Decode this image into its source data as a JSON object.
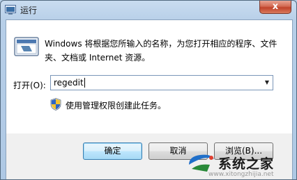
{
  "window": {
    "title": "运行",
    "close_label": "x"
  },
  "dialog": {
    "description": "Windows 将根据您所输入的名称，为您打开相应的程序、文件夹、文档或 Internet 资源。",
    "open_label": "打开(O):",
    "open_value": "regedit",
    "admin_note": "使用管理权限创建此任务。"
  },
  "buttons": {
    "ok": "确定",
    "cancel": "取消",
    "browse": "浏览(B)..."
  },
  "watermark": {
    "text": "系统之家",
    "url": "www.xitongzhijia.net"
  },
  "icons": {
    "app": "run-icon",
    "shield": "uac-shield-icon",
    "dropdown": "chevron-down-icon"
  },
  "colors": {
    "frame": "#b7cfe8",
    "close_button": "#c0432a",
    "default_button_border": "#3c7fb1"
  }
}
